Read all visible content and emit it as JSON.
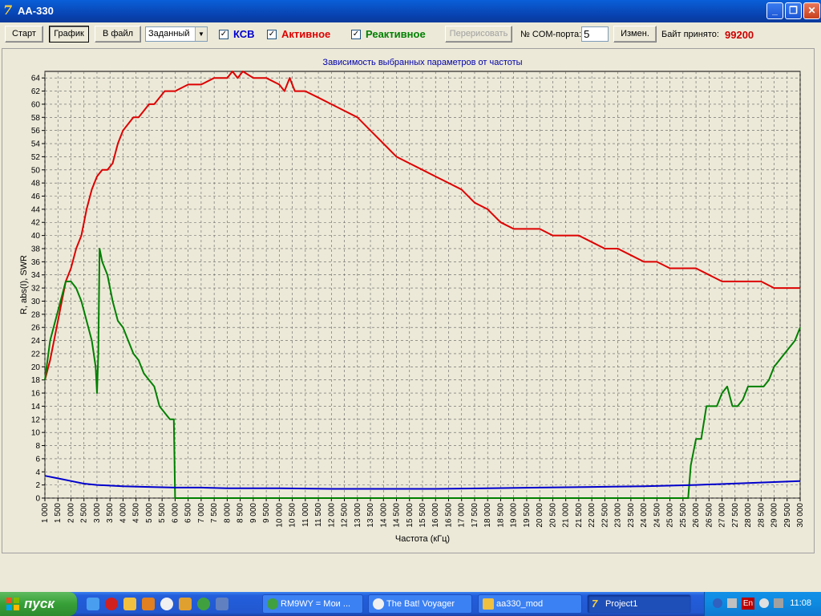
{
  "window": {
    "title": "AA-330",
    "app_icon": "aa330-app-icon"
  },
  "toolbar": {
    "start_label": "Старт",
    "graph_label": "График",
    "tofile_label": "В файл",
    "range_combo_value": "Заданный",
    "swr_checked": true,
    "swr_label": "КСВ",
    "swr_color": "#0000cc",
    "active_checked": true,
    "active_label": "Активное",
    "active_color": "#dd0000",
    "reactive_checked": true,
    "reactive_label": "Реактивное",
    "reactive_color": "#008000",
    "redraw_label": "Перерисовать",
    "com_port_label": "№ COM-порта:",
    "com_port_value": "5",
    "change_label": "Измен.",
    "bytes_label": "Байт принято:",
    "bytes_value": "99200",
    "bytes_color": "#cc0000"
  },
  "chart_data": {
    "type": "line",
    "title": "Зависимость выбранных параметров от частоты",
    "xlabel": "Частота (кГц)",
    "ylabel": "R, abs(I), SWR",
    "xlim": [
      1000,
      30000
    ],
    "ylim": [
      0,
      65
    ],
    "y_ticks": [
      0,
      2,
      4,
      6,
      8,
      10,
      12,
      14,
      16,
      18,
      20,
      22,
      24,
      26,
      28,
      30,
      32,
      34,
      36,
      38,
      40,
      42,
      44,
      46,
      48,
      50,
      52,
      54,
      56,
      58,
      60,
      62,
      64
    ],
    "x_ticks": [
      1000,
      1500,
      2000,
      2500,
      3000,
      3500,
      4000,
      4500,
      5000,
      5500,
      6000,
      6500,
      7000,
      7500,
      8000,
      8500,
      9000,
      9500,
      10000,
      10500,
      11000,
      11500,
      12000,
      12500,
      13000,
      13500,
      14000,
      14500,
      15000,
      15500,
      16000,
      16500,
      17000,
      17500,
      18000,
      18500,
      19000,
      19500,
      20000,
      20500,
      21000,
      21500,
      22000,
      22500,
      23000,
      23500,
      24000,
      24500,
      25000,
      25500,
      26000,
      26500,
      27000,
      27500,
      28000,
      28500,
      29000,
      29500,
      30000
    ],
    "x_tick_labels": [
      "1 000",
      "1 500",
      "2 000",
      "2 500",
      "3 000",
      "3 500",
      "4 000",
      "4 500",
      "5 000",
      "5 500",
      "6 000",
      "6 500",
      "7 000",
      "7 500",
      "8 000",
      "8 500",
      "9 000",
      "9 500",
      "10 000",
      "10 500",
      "11 000",
      "11 500",
      "12 000",
      "12 500",
      "13 000",
      "13 500",
      "14 000",
      "14 500",
      "15 000",
      "15 500",
      "16 000",
      "16 500",
      "17 000",
      "17 500",
      "18 000",
      "18 500",
      "19 000",
      "19 500",
      "20 000",
      "20 500",
      "21 000",
      "21 500",
      "22 000",
      "22 500",
      "23 000",
      "23 500",
      "24 000",
      "24 500",
      "25 000",
      "25 500",
      "26 000",
      "26 500",
      "27 000",
      "27 500",
      "28 000",
      "28 500",
      "29 000",
      "29 500",
      "30 000"
    ],
    "grid": true,
    "series": [
      {
        "name": "Активное",
        "color": "#dd0000",
        "x": [
          1000,
          1200,
          1400,
          1600,
          1800,
          2000,
          2200,
          2400,
          2600,
          2800,
          3000,
          3200,
          3400,
          3600,
          3800,
          4000,
          4200,
          4400,
          4600,
          4800,
          5000,
          5200,
          5400,
          5600,
          5800,
          6000,
          6500,
          7000,
          7500,
          8000,
          8200,
          8400,
          8600,
          9000,
          9500,
          10000,
          10200,
          10400,
          10600,
          11000,
          11500,
          12000,
          12500,
          13000,
          13500,
          14000,
          14500,
          15000,
          15500,
          16000,
          16500,
          17000,
          17500,
          18000,
          18500,
          19000,
          19500,
          20000,
          20500,
          21000,
          21500,
          22000,
          22500,
          23000,
          23500,
          24000,
          24500,
          25000,
          25500,
          26000,
          26500,
          27000,
          27500,
          28000,
          28500,
          29000,
          29500,
          30000
        ],
        "y": [
          18,
          21,
          25,
          29,
          33,
          35,
          38,
          40,
          44,
          47,
          49,
          50,
          50,
          51,
          54,
          56,
          57,
          58,
          58,
          59,
          60,
          60,
          61,
          62,
          62,
          62,
          63,
          63,
          64,
          64,
          65,
          64,
          65,
          64,
          64,
          63,
          62,
          64,
          62,
          62,
          61,
          60,
          59,
          58,
          56,
          54,
          52,
          51,
          50,
          49,
          48,
          47,
          45,
          44,
          42,
          41,
          41,
          41,
          40,
          40,
          40,
          39,
          38,
          38,
          37,
          36,
          36,
          35,
          35,
          35,
          34,
          33,
          33,
          33,
          33,
          32,
          32,
          32
        ]
      },
      {
        "name": "Реактивное",
        "color": "#008000",
        "x": [
          1000,
          1200,
          1400,
          1600,
          1800,
          2000,
          2200,
          2400,
          2600,
          2800,
          2950,
          3000,
          3050,
          3100,
          3200,
          3300,
          3400,
          3600,
          3800,
          4000,
          4200,
          4400,
          4600,
          4800,
          5000,
          5200,
          5400,
          5600,
          5800,
          5950,
          6000,
          6500,
          10000,
          20000,
          25000,
          25700,
          25800,
          26000,
          26200,
          26400,
          26600,
          26800,
          27000,
          27200,
          27400,
          27600,
          27800,
          28000,
          28200,
          28400,
          28600,
          28800,
          29000,
          29200,
          29400,
          29600,
          29800,
          30000
        ],
        "y": [
          18,
          24,
          27,
          30,
          33,
          33,
          32,
          30,
          27,
          24,
          20,
          16,
          22,
          38,
          36,
          35,
          34,
          30,
          27,
          26,
          24,
          22,
          21,
          19,
          18,
          17,
          14,
          13,
          12,
          12,
          0,
          0,
          0,
          0,
          0,
          0,
          5,
          9,
          9,
          14,
          14,
          14,
          16,
          17,
          14,
          14,
          15,
          17,
          17,
          17,
          17,
          18,
          20,
          21,
          22,
          23,
          24,
          26
        ]
      },
      {
        "name": "КСВ",
        "color": "#0000cc",
        "x": [
          1000,
          1500,
          2000,
          2500,
          3000,
          4000,
          5000,
          6000,
          7000,
          8000,
          10000,
          12000,
          14000,
          16000,
          18000,
          20000,
          22000,
          24000,
          26000,
          28000,
          30000
        ],
        "y": [
          3.4,
          3.0,
          2.6,
          2.2,
          2.0,
          1.8,
          1.7,
          1.6,
          1.6,
          1.5,
          1.5,
          1.4,
          1.4,
          1.4,
          1.5,
          1.6,
          1.7,
          1.8,
          2.0,
          2.3,
          2.6
        ]
      }
    ]
  },
  "taskbar": {
    "start_label": "пуск",
    "tasks": [
      {
        "label": "RM9WY = Мои ...",
        "icon": "chrome-icon"
      },
      {
        "label": "The Bat! Voyager",
        "icon": "bat-icon"
      },
      {
        "label": "aa330_mod",
        "icon": "folder-icon"
      },
      {
        "label": "Project1",
        "icon": "aa330-app-icon"
      }
    ],
    "lang": "En",
    "clock": "11:08"
  }
}
